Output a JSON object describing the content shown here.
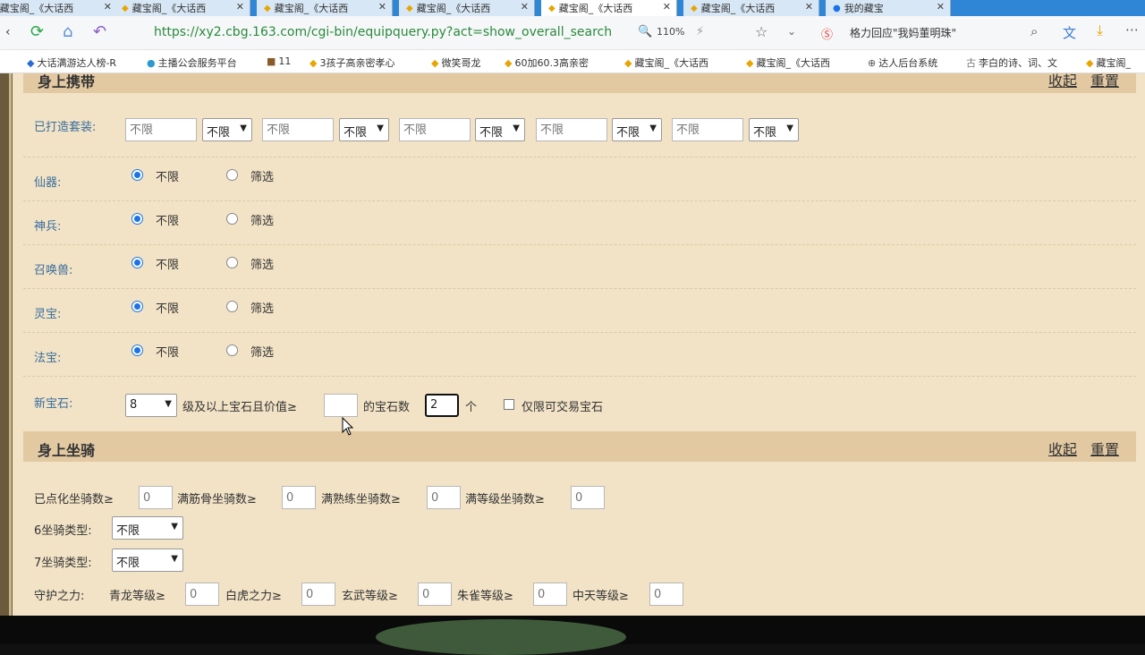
{
  "browser": {
    "tabs": [
      {
        "label": "藏宝阁_《大话西"
      },
      {
        "label": "藏宝阁_《大话西"
      },
      {
        "label": "藏宝阁_《大话西"
      },
      {
        "label": "藏宝阁_《大话西"
      },
      {
        "label": "藏宝阁_《大话西"
      },
      {
        "label": "藏宝阁_《大话西"
      },
      {
        "label": "我的藏宝"
      }
    ],
    "url": "https://xy2.cbg.163.com/cgi-bin/equipquery.py?act=show_overall_search",
    "zoom": "110%",
    "promo": "格力回应\"我妈董明珠\"",
    "bookmarks": [
      {
        "label": "大话满游达人榜-R"
      },
      {
        "label": "主播公会服务平台"
      },
      {
        "label": "11"
      },
      {
        "label": "3孩子高亲密孝心"
      },
      {
        "label": "微笑哥龙"
      },
      {
        "label": "60加60.3高亲密"
      },
      {
        "label": "藏宝阁_《大话西"
      },
      {
        "label": "藏宝阁_《大话西"
      },
      {
        "label": "达人后台系统"
      },
      {
        "label": "李白的诗、词、文"
      },
      {
        "label": "藏宝阁_"
      }
    ]
  },
  "carry": {
    "title": "身上携带",
    "collapse": "收起",
    "reset": "重置",
    "set_label": "已打造套装:",
    "placeholder": "不限",
    "select_value": "不限",
    "rows": [
      {
        "label": "仙器:",
        "opt1": "不限",
        "opt2": "筛选"
      },
      {
        "label": "神兵:",
        "opt1": "不限",
        "opt2": "筛选"
      },
      {
        "label": "召唤兽:",
        "opt1": "不限",
        "opt2": "筛选"
      },
      {
        "label": "灵宝:",
        "opt1": "不限",
        "opt2": "筛选"
      },
      {
        "label": "法宝:",
        "opt1": "不限",
        "opt2": "筛选"
      }
    ],
    "gem_label": "新宝石:",
    "gem_level": "8",
    "gem_text1": "级及以上宝石且价值≥",
    "gem_text2": "的宝石数",
    "gem_count": "2",
    "gem_unit": "个",
    "gem_trade": "仅限可交易宝石"
  },
  "mount": {
    "title": "身上坐骑",
    "collapse": "收起",
    "reset": "重置",
    "f1": "已点化坐骑数≥",
    "v1": "0",
    "f2": "满筋骨坐骑数≥",
    "v2": "0",
    "f3": "满熟练坐骑数≥",
    "v3": "0",
    "f4": "满等级坐骑数≥",
    "v4": "0",
    "type6": "6坐骑类型:",
    "type6_val": "不限",
    "type7": "7坐骑类型:",
    "type7_val": "不限",
    "guard": "守护之力:",
    "g1": "青龙等级≥",
    "gv1": "0",
    "g2": "白虎之力≥",
    "gv2": "0",
    "g3": "玄武等级≥",
    "gv3": "0",
    "g4": "朱雀等级≥",
    "gv4": "0",
    "g5": "中天等级≥",
    "gv5": "0"
  }
}
